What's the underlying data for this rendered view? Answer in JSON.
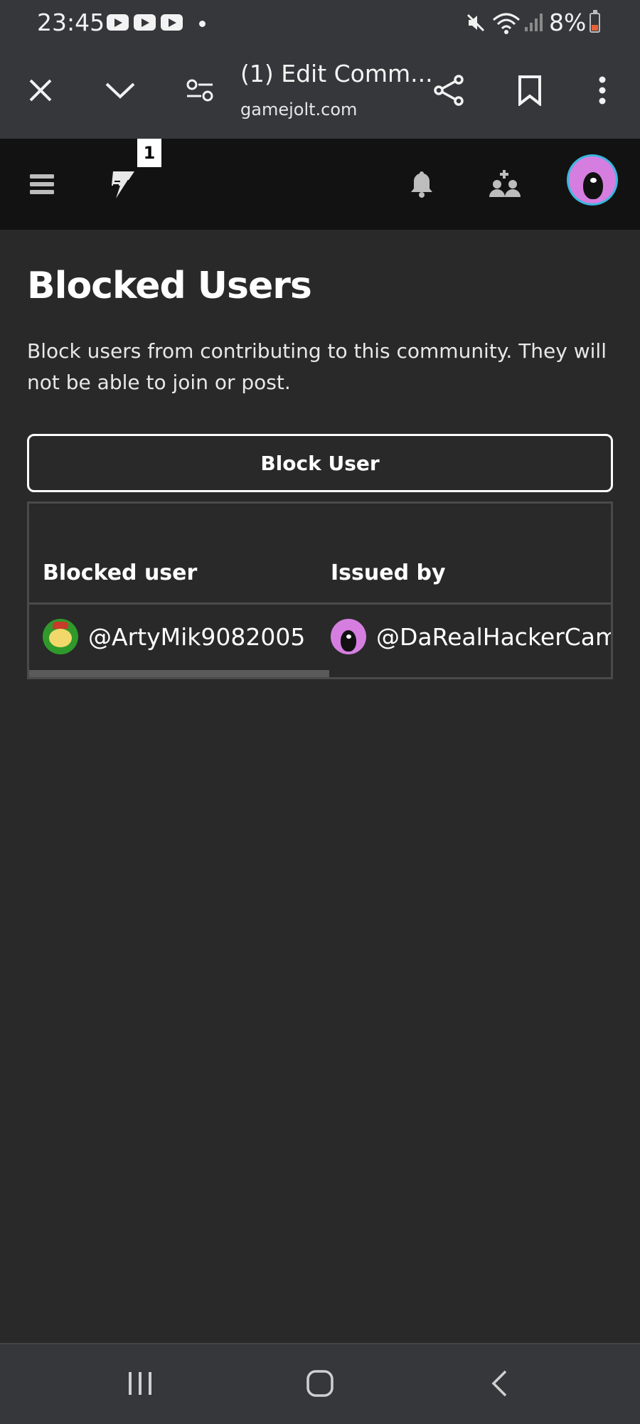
{
  "status_bar": {
    "time": "23:45",
    "battery": "8%",
    "icons": [
      "youtube-icon",
      "youtube-icon",
      "youtube-icon",
      "notification-dot-icon",
      "mute-icon",
      "wifi-icon",
      "signal-icon",
      "battery-icon"
    ]
  },
  "browser": {
    "tab_title": "(1) Edit Comm...",
    "url": "gamejolt.com",
    "buttons": [
      "close-icon",
      "chevron-down-icon",
      "page-settings-icon",
      "share-icon",
      "bookmark-icon",
      "more-icon"
    ]
  },
  "site_header": {
    "notification_badge": "1",
    "icons": [
      "menu-icon",
      "gamejolt-logo-icon",
      "bell-icon",
      "friends-icon",
      "user-avatar"
    ]
  },
  "page": {
    "title": "Blocked Users",
    "description": "Block users from contributing to this community. They will not be able to join or post.",
    "block_button": "Block User"
  },
  "table": {
    "headers": {
      "blocked_user": "Blocked user",
      "issued_by": "Issued by"
    },
    "rows": [
      {
        "blocked_user": "@ArtyMik9082005",
        "issued_by": "@DaRealHackerCam"
      }
    ],
    "scroll_position": 0.5
  },
  "colors": {
    "background": "#292929",
    "header": "#121212",
    "browser_chrome": "#36373b",
    "text": "#ffffff",
    "avatar_ring": "#3ab7e0",
    "battery_low": "#e8613a"
  }
}
